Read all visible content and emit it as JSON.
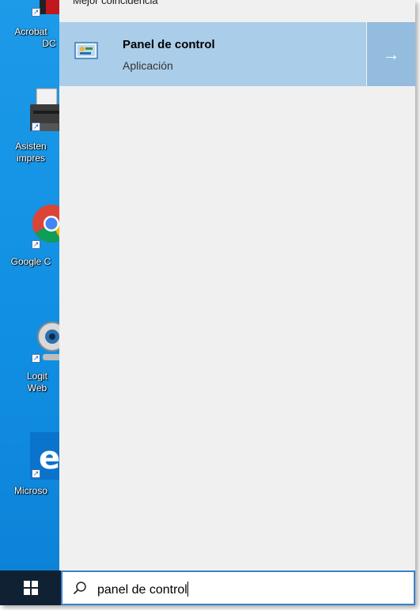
{
  "desktop": {
    "icons": [
      {
        "name": "acrobat",
        "label_line1": "Acrobat",
        "label_line2": "DC",
        "icon": "acrobat-icon"
      },
      {
        "name": "asistente",
        "label_line1": "Asisten",
        "label_line2": "impres",
        "icon": "printer-icon"
      },
      {
        "name": "google-chrome",
        "label_line1": "Google C",
        "label_line2": "",
        "icon": "chrome-icon"
      },
      {
        "name": "logitech",
        "label_line1": "Logit",
        "label_line2": "Web",
        "icon": "webcam-icon"
      },
      {
        "name": "microsoft-edge",
        "label_line1": "Microso",
        "label_line2": "",
        "icon": "edge-icon"
      }
    ]
  },
  "search_results": {
    "section_header": "Mejor coincidencia",
    "best_match": {
      "title": "Panel de control",
      "subtitle": "Aplicación",
      "icon": "control-panel-icon",
      "open_arrow": "→"
    }
  },
  "taskbar": {
    "start_icon": "windows-logo-icon",
    "search_icon": "search-icon",
    "search_query": "panel de control"
  },
  "colors": {
    "desktop_blue": "#1190e3",
    "panel_bg": "#f0f0f0",
    "best_match_bg": "#aacde9",
    "arrow_bg": "#94bcde",
    "taskbar_bg": "#0f2133",
    "search_border": "#3a80c8"
  }
}
